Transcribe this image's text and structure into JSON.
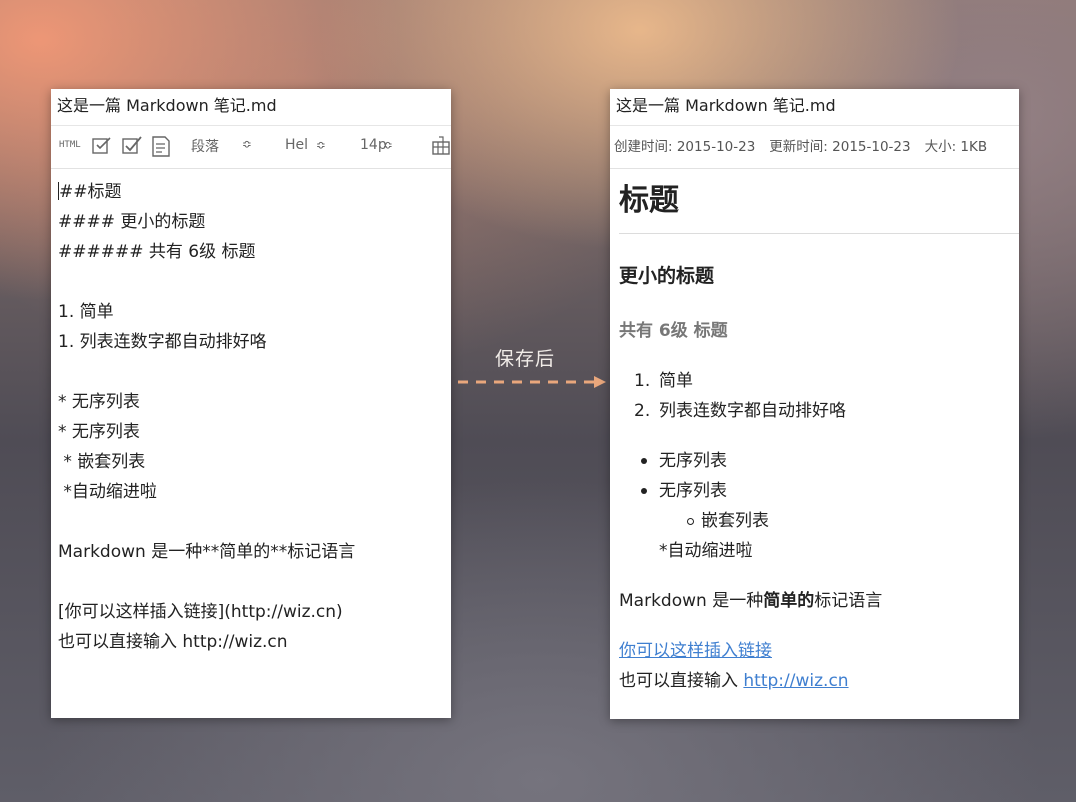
{
  "editor": {
    "title": "这是一篇 Markdown 笔记.md",
    "toolbar": {
      "html_label": "HTML",
      "paragraph_style": "段落",
      "font": "Hel",
      "font_size": "14p"
    },
    "lines": [
      "##标题",
      "#### 更小的标题",
      "###### 共有 6级 标题",
      "",
      "1. 简单",
      "1. 列表连数字都自动排好咯",
      "",
      "* 无序列表",
      "* 无序列表",
      " * 嵌套列表",
      " *自动缩进啦",
      "",
      "Markdown 是一种**简单的**标记语言",
      "",
      "[你可以这样插入链接](http://wiz.cn)",
      "也可以直接输入 http://wiz.cn"
    ]
  },
  "arrow": {
    "label": "保存后",
    "color": "#e9a77c"
  },
  "preview": {
    "title": "这是一篇 Markdown 笔记.md",
    "meta": {
      "created": "创建时间: 2015-10-23",
      "updated": "更新时间: 2015-10-23",
      "size": "大小: 1KB"
    },
    "h1": "标题",
    "h4": "更小的标题",
    "h6": "共有 6级 标题",
    "ordered": [
      {
        "num": "1.",
        "text": "简单"
      },
      {
        "num": "2.",
        "text": "列表连数字都自动排好咯"
      }
    ],
    "unordered": [
      "无序列表",
      "无序列表"
    ],
    "nested": "嵌套列表",
    "nested_plain": "*自动缩进啦",
    "para": {
      "prefix": "Markdown 是一种",
      "bold": "简单的",
      "suffix": "标记语言"
    },
    "link_text": "你可以这样插入链接",
    "direct_prefix": "也可以直接输入 ",
    "direct_url": "http://wiz.cn",
    "link_color": "#3f7fd0"
  }
}
